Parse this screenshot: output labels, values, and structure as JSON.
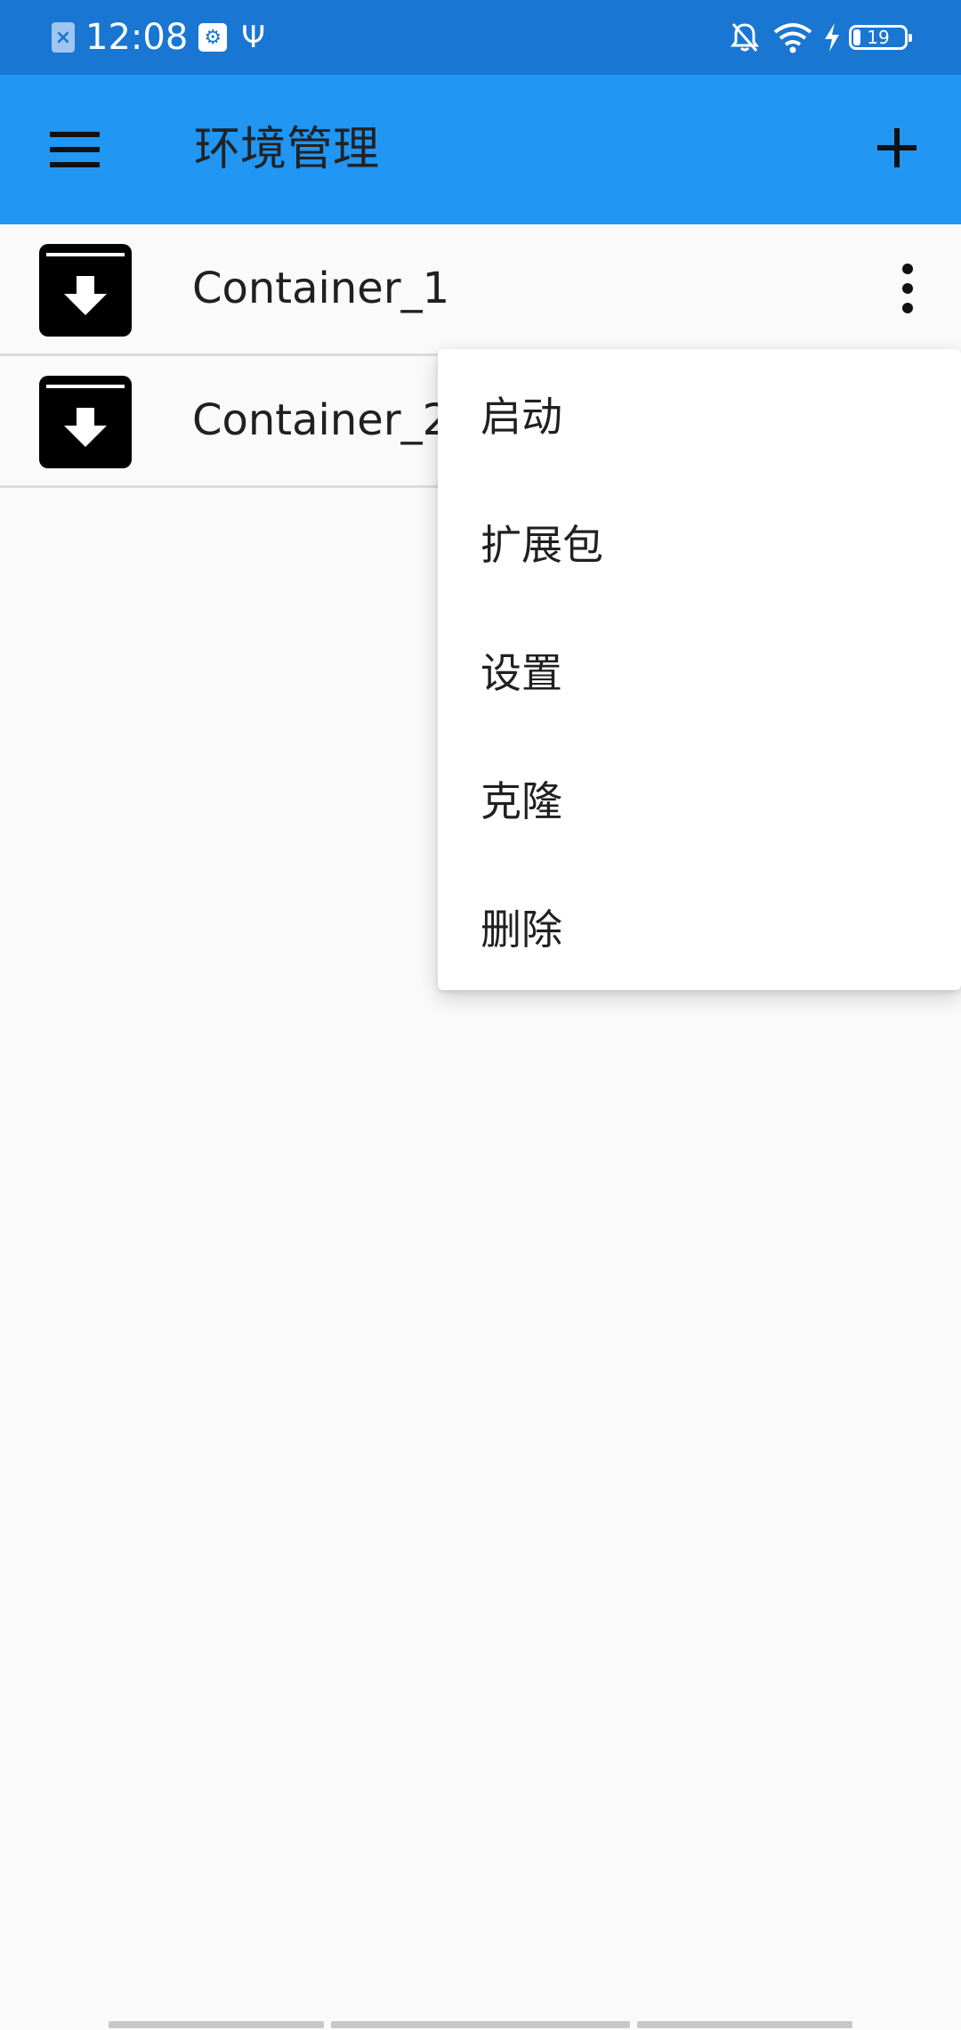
{
  "status_bar": {
    "time": "12:08",
    "sim_icon": "sim-error-icon",
    "sim_glyph": "×",
    "usb_debug_glyph": "⚙",
    "usb_glyph": "Ψ",
    "battery_level": "19",
    "icons": [
      "sim-error-icon",
      "usb-debug-icon",
      "usb-icon",
      "bell-off-icon",
      "wifi-icon",
      "charging-icon",
      "battery-icon"
    ]
  },
  "app_bar": {
    "title": "环境管理",
    "menu_icon": "hamburger-menu-icon",
    "add_icon": "plus-icon",
    "background": "#2196f3"
  },
  "containers": [
    {
      "name": "Container_1",
      "icon": "archive-download-icon"
    },
    {
      "name": "Container_2",
      "icon": "archive-download-icon"
    }
  ],
  "popup_menu": {
    "items": [
      "启动",
      "扩展包",
      "设置",
      "克隆",
      "删除"
    ]
  },
  "colors": {
    "status_bar": "#1976d2",
    "app_bar": "#2196f3",
    "background": "#fafafa"
  }
}
